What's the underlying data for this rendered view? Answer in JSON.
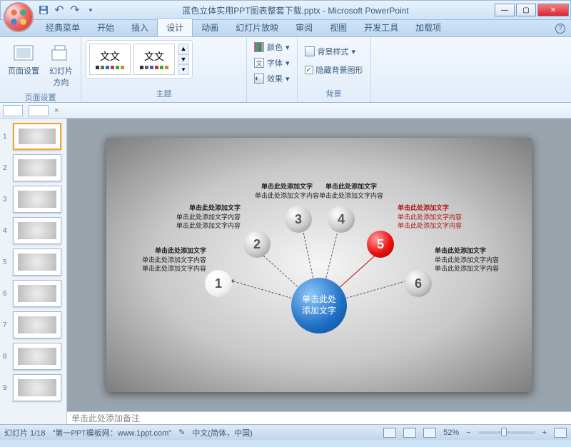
{
  "title": "蓝色立体实用PPT图表整套下载.pptx - Microsoft PowerPoint",
  "tabs": {
    "t0": "经典菜单",
    "t1": "开始",
    "t2": "插入",
    "t3": "设计",
    "t4": "动画",
    "t5": "幻灯片放映",
    "t6": "审阅",
    "t7": "视图",
    "t8": "开发工具",
    "t9": "加载项"
  },
  "ribbon": {
    "page_setup": {
      "label": "页面设置",
      "btn_setup": "页面设置",
      "btn_orient": "幻灯片\n方向"
    },
    "themes": {
      "label": "主题"
    },
    "variants": {
      "colors": "颜色",
      "fonts": "字体",
      "effects": "效果"
    },
    "background": {
      "label": "背景",
      "styles": "背景样式",
      "hide": "隐藏背景图形"
    }
  },
  "thumbs": {
    "n1": "1",
    "n2": "2",
    "n3": "3",
    "n4": "4",
    "n5": "5",
    "n6": "6",
    "n7": "7",
    "n8": "8",
    "n9": "9"
  },
  "slide": {
    "center": "单击此处\n添加文字",
    "nodes": {
      "n1": "1",
      "n2": "2",
      "n3": "3",
      "n4": "4",
      "n5": "5",
      "n6": "6"
    },
    "cap": {
      "n1": {
        "h": "单击此处添加文字",
        "l1": "单击此处添加文字内容",
        "l2": "单击此处添加文字内容"
      },
      "n2": {
        "h": "单击此处添加文字",
        "l1": "单击此处添加文字内容",
        "l2": "单击此处添加文字内容"
      },
      "n3": {
        "h": "单击此处添加文字",
        "l1": "单击此处添加文字内容"
      },
      "n4": {
        "h": "单击此处添加文字",
        "l1": "单击此处添加文字内容"
      },
      "n5": {
        "h": "单击此处添加文字",
        "l1": "单击此处添加文字内容",
        "l2": "单击此处添加文字内容"
      },
      "n6": {
        "h": "单击此处添加文字",
        "l1": "单击此处添加文字内容",
        "l2": "单击此处添加文字内容"
      }
    }
  },
  "notes_placeholder": "单击此处添加备注",
  "status": {
    "slide": "幻灯片 1/18",
    "template": "\"第一PPT模板网：www.1ppt.com\"",
    "lang": "中文(简体，中国)",
    "zoom": "52%"
  }
}
